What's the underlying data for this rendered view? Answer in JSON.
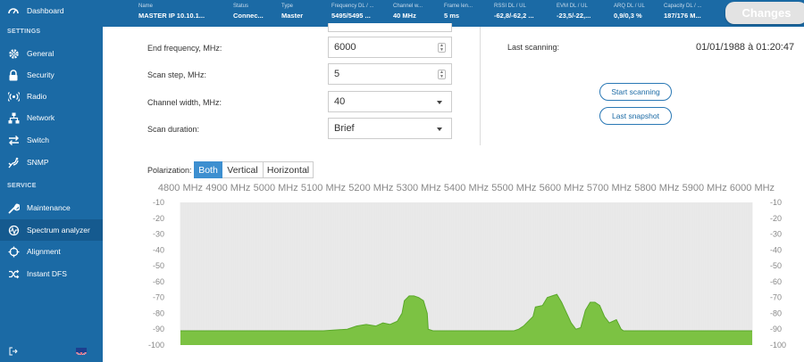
{
  "sidebar": {
    "items_top": [
      {
        "label": "Dashboard",
        "icon": "dashboard-icon"
      }
    ],
    "section_settings": "SETTINGS",
    "settings_items": [
      {
        "label": "General",
        "icon": "gear-icon"
      },
      {
        "label": "Security",
        "icon": "lock-icon"
      },
      {
        "label": "Radio",
        "icon": "radio-icon"
      },
      {
        "label": "Network",
        "icon": "network-icon"
      },
      {
        "label": "Switch",
        "icon": "switch-icon"
      },
      {
        "label": "SNMP",
        "icon": "snmp-icon"
      }
    ],
    "section_service": "SERVICE",
    "service_items": [
      {
        "label": "Maintenance",
        "icon": "wrench-icon"
      },
      {
        "label": "Spectrum analyzer",
        "icon": "spectrum-icon"
      },
      {
        "label": "Alignment",
        "icon": "alignment-icon"
      },
      {
        "label": "Instant DFS",
        "icon": "shuffle-icon"
      }
    ]
  },
  "topbar": {
    "columns": [
      {
        "label": "Name",
        "value": "MASTER IP 10.10.1..."
      },
      {
        "label": "Status",
        "value": "Connec..."
      },
      {
        "label": "Type",
        "value": "Master"
      },
      {
        "label": "Frequency DL / ...",
        "value": "5495/5495 ..."
      },
      {
        "label": "Channel w...",
        "value": "40 MHz"
      },
      {
        "label": "Frame len...",
        "value": "5 ms"
      },
      {
        "label": "RSSI DL / UL",
        "value": "-62,8/-62,2 ..."
      },
      {
        "label": "EVM DL / UL",
        "value": "-23,5/-22,..."
      },
      {
        "label": "ARQ DL / UL",
        "value": "0,9/0,3 %"
      },
      {
        "label": "Capacity DL / ...",
        "value": "187/176 M..."
      }
    ],
    "changes_label": "Changes"
  },
  "form": {
    "end_freq_label": "End frequency, MHz:",
    "end_freq_value": "6000",
    "scan_step_label": "Scan step, MHz:",
    "scan_step_value": "5",
    "channel_width_label": "Channel width, MHz:",
    "channel_width_value": "40",
    "scan_duration_label": "Scan duration:",
    "scan_duration_value": "Brief"
  },
  "scan": {
    "last_scanning_label": "Last scanning:",
    "last_scanning_value": "01/01/1988 à 01:20:47",
    "start_button": "Start scanning",
    "snapshot_button": "Last snapshot"
  },
  "polarization": {
    "label": "Polarization:",
    "options": [
      "Both",
      "Vertical",
      "Horizontal"
    ],
    "selected": "Both"
  },
  "colors": {
    "sidebar": "#1b6aa5",
    "accent": "#3d8fd0",
    "spectrum_fill": "#7cc243",
    "spectrum_line": "#5aa82a"
  },
  "chart_data": {
    "type": "area",
    "x_ticks": [
      "4800 MHz",
      "4900 MHz",
      "5000 MHz",
      "5100 MHz",
      "5200 MHz",
      "5300 MHz",
      "5400 MHz",
      "5500 MHz",
      "5600 MHz",
      "5700 MHz",
      "5800 MHz",
      "5900 MHz",
      "6000 MHz"
    ],
    "y_ticks": [
      "-10",
      "-20",
      "-30",
      "-40",
      "-50",
      "-60",
      "-70",
      "-80",
      "-90",
      "-100"
    ],
    "xlim": [
      4800,
      6000
    ],
    "ylim": [
      -100,
      -10
    ],
    "grid": false,
    "series": [
      {
        "x": [
          4800,
          5000,
          5100,
          5150,
          5170,
          5190,
          5210,
          5225,
          5240,
          5255,
          5265,
          5270,
          5280,
          5290,
          5300,
          5310,
          5318,
          5320,
          5330,
          5340,
          5500,
          5510,
          5520,
          5530,
          5540,
          5545,
          5560,
          5570,
          5580,
          5590,
          5600,
          5620,
          5630,
          5640,
          5650,
          5660,
          5670,
          5680,
          5690,
          5700,
          5715,
          5725,
          5730,
          6000
        ],
        "y": [
          -91,
          -91,
          -91,
          -90,
          -88,
          -87,
          -88,
          -86,
          -87,
          -85,
          -80,
          -72,
          -69,
          -69,
          -70,
          -72,
          -80,
          -90,
          -91,
          -91,
          -91,
          -90,
          -88,
          -85,
          -82,
          -76,
          -75,
          -70,
          -69,
          -68,
          -73,
          -86,
          -90,
          -89,
          -78,
          -73,
          -73,
          -75,
          -82,
          -86,
          -84,
          -90,
          -91,
          -91
        ]
      }
    ]
  }
}
